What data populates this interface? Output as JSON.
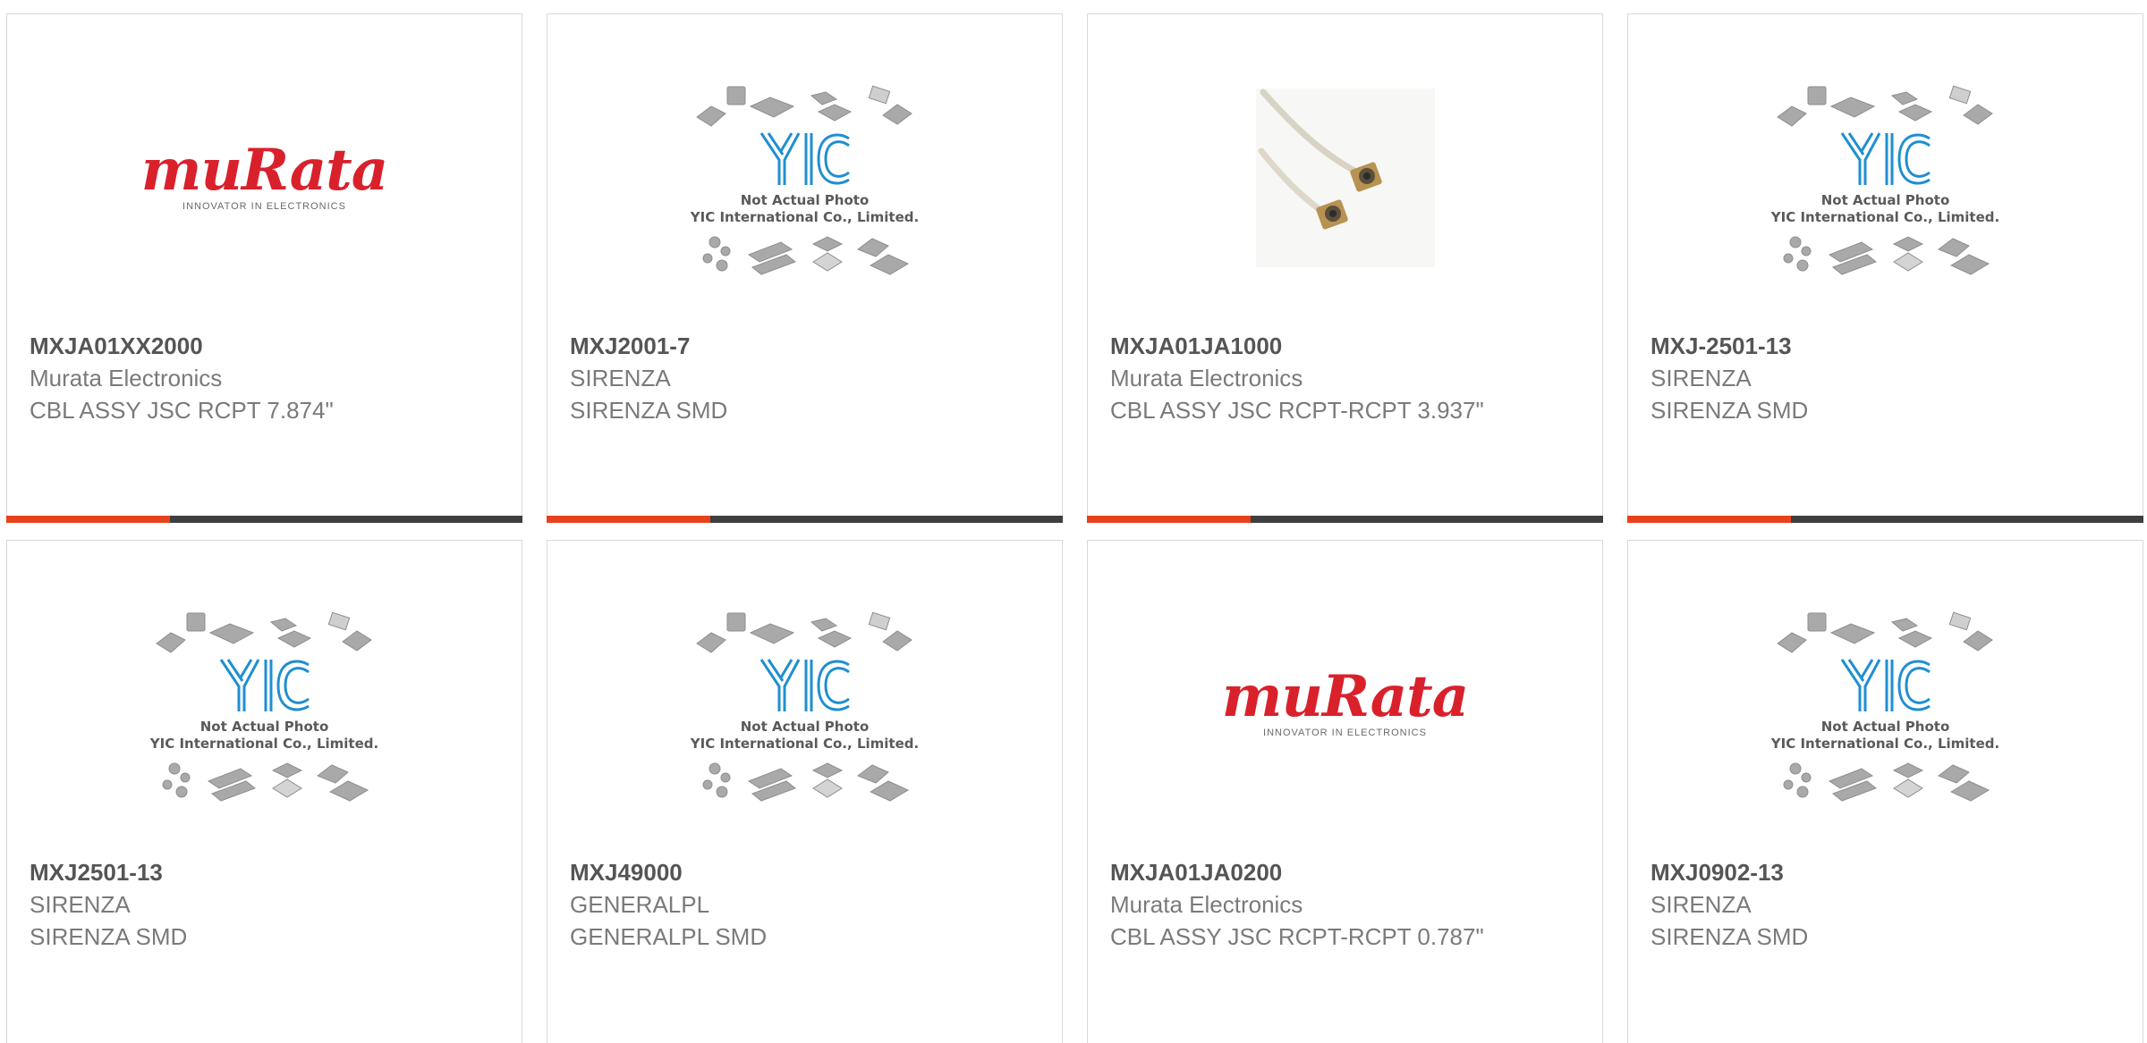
{
  "theme": {
    "accent": "#e8421c",
    "bar": "#3f3f3f",
    "murata_red": "#d9212c",
    "yic_blue": "#1f8fd0"
  },
  "products": [
    {
      "part_number": "MXJA01XX2000",
      "manufacturer": "Murata Electronics",
      "description": "CBL ASSY JSC RCPT 7.874\"",
      "image": "murata-logo"
    },
    {
      "part_number": "MXJ2001-7",
      "manufacturer": "SIRENZA",
      "description": "SIRENZA SMD",
      "image": "yic-placeholder"
    },
    {
      "part_number": "MXJA01JA1000",
      "manufacturer": "Murata Electronics",
      "description": "CBL ASSY JSC RCPT-RCPT 3.937\"",
      "image": "cable-photo"
    },
    {
      "part_number": "MXJ-2501-13",
      "manufacturer": "SIRENZA",
      "description": "SIRENZA SMD",
      "image": "yic-placeholder"
    },
    {
      "part_number": "MXJ2501-13",
      "manufacturer": "SIRENZA",
      "description": "SIRENZA SMD",
      "image": "yic-placeholder"
    },
    {
      "part_number": "MXJ49000",
      "manufacturer": "GENERALPL",
      "description": "GENERALPL SMD",
      "image": "yic-placeholder"
    },
    {
      "part_number": "MXJA01JA0200",
      "manufacturer": "Murata Electronics",
      "description": "CBL ASSY JSC RCPT-RCPT 0.787\"",
      "image": "murata-logo"
    },
    {
      "part_number": "MXJ0902-13",
      "manufacturer": "SIRENZA",
      "description": "SIRENZA SMD",
      "image": "yic-placeholder"
    }
  ],
  "murata_logo": {
    "word": "muRata",
    "tagline": "INNOVATOR IN ELECTRONICS"
  },
  "yic_placeholder": {
    "line1": "Not Actual Photo",
    "line2": "YIC International Co., Limited.",
    "mark": "YIC"
  }
}
